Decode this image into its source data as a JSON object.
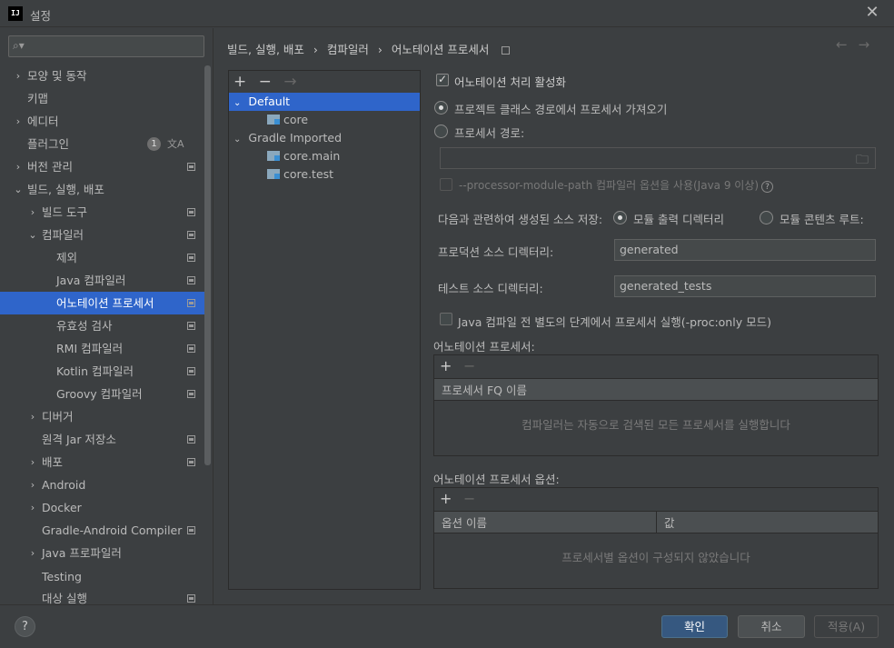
{
  "window": {
    "title": "설정",
    "app_icon": "IJ"
  },
  "search": {
    "placeholder": "",
    "icon": "search-icon"
  },
  "sidebar": {
    "items": [
      {
        "label": "모양 및 동작",
        "chevron": "›"
      },
      {
        "label": "키맵"
      },
      {
        "label": "에디터",
        "chevron": "›"
      },
      {
        "label": "플러그인",
        "badge": "1"
      },
      {
        "label": "버전 관리",
        "chevron": "›"
      },
      {
        "label": "빌드, 실행, 배포",
        "chevron": "⌄"
      },
      {
        "label": "빌드 도구",
        "chevron": "›"
      },
      {
        "label": "컴파일러",
        "chevron": "⌄"
      },
      {
        "label": "제외"
      },
      {
        "label": "Java 컴파일러"
      },
      {
        "label": "어노테이션 프로세서"
      },
      {
        "label": "유효성 검사"
      },
      {
        "label": "RMI 컴파일러"
      },
      {
        "label": "Kotlin 컴파일러"
      },
      {
        "label": "Groovy 컴파일러"
      },
      {
        "label": "디버거",
        "chevron": "›"
      },
      {
        "label": "원격 Jar 저장소"
      },
      {
        "label": "배포",
        "chevron": "›"
      },
      {
        "label": "Android",
        "chevron": "›"
      },
      {
        "label": "Docker",
        "chevron": "›"
      },
      {
        "label": "Gradle-Android Compiler"
      },
      {
        "label": "Java 프로파일러",
        "chevron": "›"
      },
      {
        "label": "Testing"
      },
      {
        "label": "대상 실행"
      }
    ]
  },
  "breadcrumb": {
    "part1": "빌드, 실행, 배포",
    "sep": "›",
    "part2": "컴파일러",
    "part3": "어노테이션 프로세서"
  },
  "nav": {
    "back": "←",
    "forward": "→"
  },
  "profiles": {
    "toolbar": {
      "add": "+",
      "remove": "−",
      "move": "→"
    },
    "items": [
      {
        "label": "Default"
      },
      {
        "label": "core"
      },
      {
        "label": "Gradle Imported"
      },
      {
        "label": "core.main"
      },
      {
        "label": "core.test"
      }
    ]
  },
  "form": {
    "enable_label": "어노테이션 처리 활성화",
    "enable_checked": true,
    "from_classpath_label": "프로젝트 클래스 경로에서 프로세서 가져오기",
    "processor_path_label": "프로세서 경로:",
    "processor_path_value": "",
    "module_path_label": "--processor-module-path 컴파일러 옵션을 사용(Java 9 이상)",
    "help_glyph": "?",
    "store_label": "다음과 관련하여 생성된 소스 저장:",
    "store_option1": "모듈 출력 디렉터리",
    "store_option2": "모듈 콘텐츠 루트:",
    "prod_dir_label": "프로덕션 소스 디렉터리:",
    "prod_dir_value": "generated",
    "test_dir_label": "테스트 소스 디렉터리:",
    "test_dir_value": "generated_tests",
    "proc_only_label": "Java 컴파일 전 별도의 단계에서 프로세서 실행(-proc:only 모드)"
  },
  "processors": {
    "title": "어노테이션 프로세서:",
    "add": "+",
    "remove": "−",
    "column": "프로세서 FQ 이름",
    "empty": "컴파일러는 자동으로 검색된 모든 프로세서를 실행합니다"
  },
  "options": {
    "title": "어노테이션 프로세서 옵션:",
    "add": "+",
    "remove": "−",
    "col_name": "옵션 이름",
    "col_value": "값",
    "empty": "프로세서별 옵션이 구성되지 않았습니다"
  },
  "footer": {
    "help": "?",
    "ok": "확인",
    "cancel": "취소",
    "apply": "적용(A)"
  },
  "colors": {
    "accent": "#2f65ca",
    "bg": "#3c3f41",
    "ok_button": "#365880"
  }
}
